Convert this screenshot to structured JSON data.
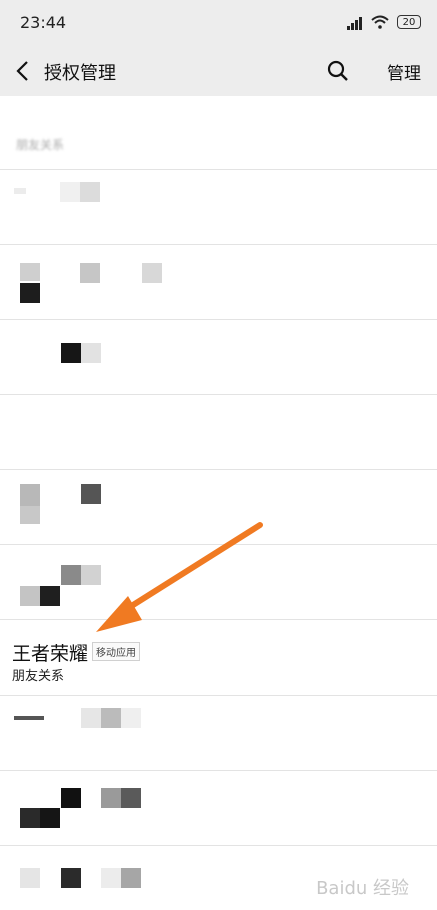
{
  "status_bar": {
    "time": "23:44",
    "battery": "20"
  },
  "header": {
    "title": "授权管理",
    "manage_label": "管理"
  },
  "rows": {
    "top_partial_label": "朋友关系",
    "app": {
      "name": "王者荣耀",
      "badge": "移动应用",
      "subtitle": "朋友关系"
    }
  },
  "watermark": "Baidu 经验",
  "colors": {
    "header_bg": "#ededed",
    "arrow": "#f07a22"
  }
}
